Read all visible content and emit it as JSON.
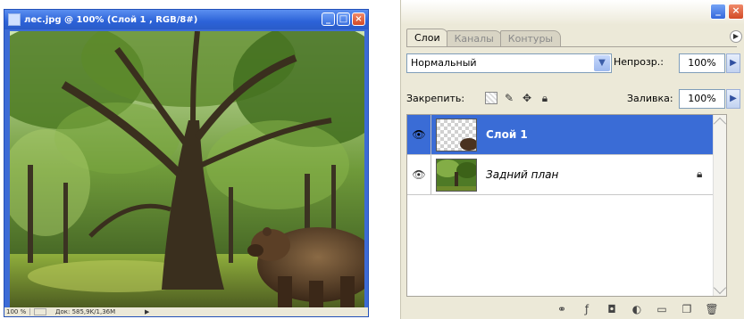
{
  "document_window": {
    "title": "лес.jpg @ 100% (Слой 1 , RGB/8#)",
    "buttons": {
      "minimize": "_",
      "maximize": "□",
      "close": "×"
    },
    "status": {
      "zoom": "100 %",
      "doc_info": "Док: 585,9K/1,36M",
      "arrow": "▶"
    }
  },
  "layers_panel": {
    "window_buttons": {
      "minimize": "_",
      "close": "×"
    },
    "tabs": [
      {
        "label": "Слои",
        "active": true
      },
      {
        "label": "Каналы",
        "active": false
      },
      {
        "label": "Контуры",
        "active": false
      }
    ],
    "menu_button": "▶",
    "blend_mode": "Нормальный",
    "opacity_label": "Непрозр.:",
    "opacity_value": "100%",
    "lock_label": "Закрепить:",
    "fill_label": "Заливка:",
    "fill_value": "100%",
    "layers": [
      {
        "name": "Слой 1",
        "selected": true,
        "visible": true
      },
      {
        "name": "Задний план",
        "selected": false,
        "visible": true,
        "locked": true
      }
    ],
    "icons": {
      "eye": "eye-icon",
      "lock": "lock-icon",
      "link": "link-icon",
      "fx": "layer-style-icon",
      "mask": "mask-icon",
      "adjust": "adjustment-layer-icon",
      "group": "new-group-icon",
      "new": "new-layer-icon",
      "trash": "trash-icon"
    }
  }
}
